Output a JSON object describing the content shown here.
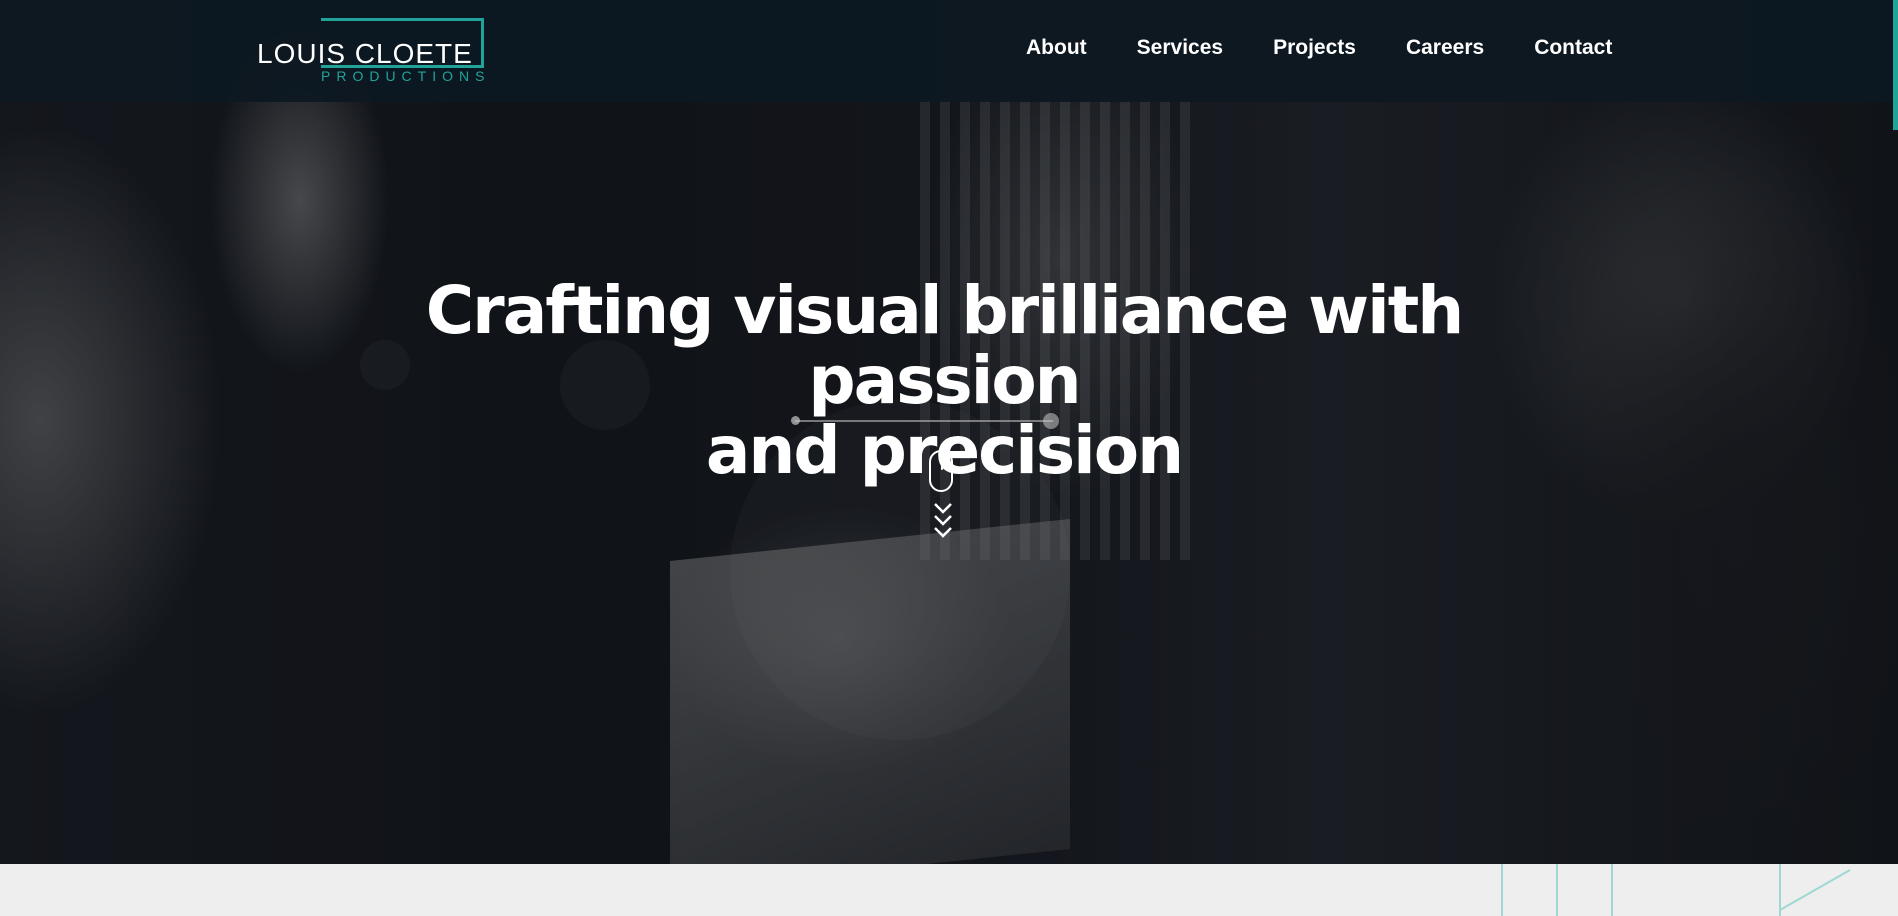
{
  "header": {
    "logo": {
      "main": "LOUIS CLOETE",
      "sub": "PRODUCTIONS"
    },
    "nav": [
      {
        "label": "About"
      },
      {
        "label": "Services"
      },
      {
        "label": "Projects"
      },
      {
        "label": "Careers"
      },
      {
        "label": "Contact"
      }
    ]
  },
  "hero": {
    "headline_line1": "Crafting visual brilliance with passion",
    "headline_line2": "and precision",
    "scroll_icon": "mouse-scroll-icon",
    "scroll_arrows_icon": "chevrons-down-icon"
  },
  "colors": {
    "accent": "#21a39a",
    "header_bg": "#0d1822",
    "text": "#ffffff",
    "bottom_strip": "#eeeeee"
  }
}
